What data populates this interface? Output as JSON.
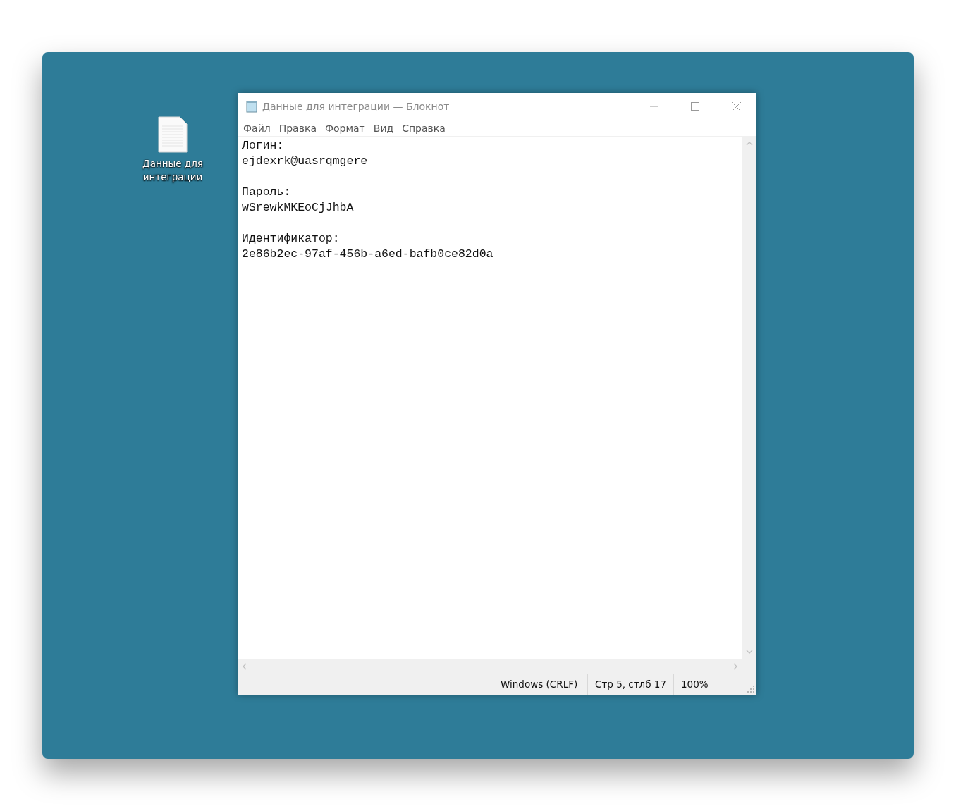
{
  "desktop": {
    "icons": [
      {
        "label": "Данные для интеграции"
      }
    ]
  },
  "window": {
    "title": "Данные для интеграции — Блокнот",
    "menu": [
      "Файл",
      "Правка",
      "Формат",
      "Вид",
      "Справка"
    ],
    "entries": [
      {
        "label": "Логин:",
        "value": "ejdexrk@uasrqmgere"
      },
      {
        "label": "Пароль:",
        "value": "wSrewkMKEoCjJhbA"
      },
      {
        "label": "Идентификатор:",
        "value": "2e86b2ec-97af-456b-a6ed-bafb0ce82d0a"
      }
    ],
    "status_bar": [
      "Windows (CRLF)",
      "Стр 5, стлб 17",
      "100%"
    ]
  }
}
